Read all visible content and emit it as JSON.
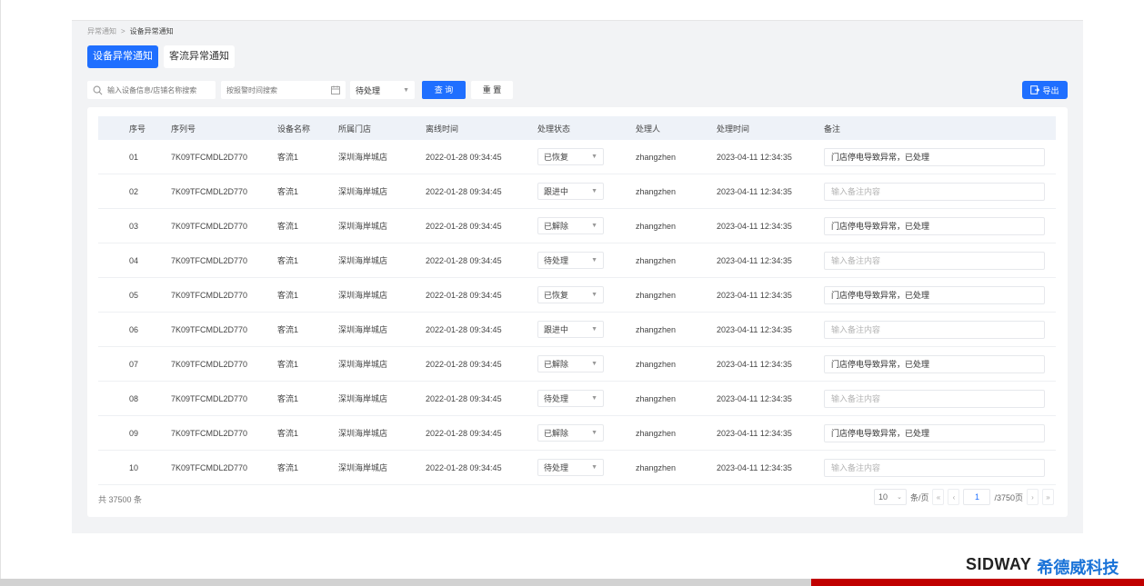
{
  "breadcrumb": {
    "parent": "异常通知",
    "separator": ">",
    "current": "设备异常通知"
  },
  "tabs": [
    {
      "label": "设备异常通知",
      "active": true
    },
    {
      "label": "客流异常通知",
      "active": false
    }
  ],
  "filters": {
    "search_placeholder": "输入设备信息/店铺名称搜索",
    "date_placeholder": "按报警时间搜索",
    "status_value": "待处理",
    "query_label": "查 询",
    "reset_label": "重 置",
    "export_label": "导出"
  },
  "table": {
    "columns": [
      "序号",
      "序列号",
      "设备名称",
      "所属门店",
      "离线时间",
      "处理状态",
      "处理人",
      "处理时间",
      "备注"
    ],
    "rows": [
      {
        "no": "01",
        "serial": "7K09TFCMDL2D770",
        "device": "客流1",
        "store": "深圳海岸城店",
        "offline": "2022-01-28 09:34:45",
        "status": "已恢复",
        "handler": "zhangzhen",
        "handled": "2023-04-11 12:34:35",
        "remark": "门店停电导致异常，已处理",
        "remark_ph": ""
      },
      {
        "no": "02",
        "serial": "7K09TFCMDL2D770",
        "device": "客流1",
        "store": "深圳海岸城店",
        "offline": "2022-01-28 09:34:45",
        "status": "跟进中",
        "handler": "zhangzhen",
        "handled": "2023-04-11 12:34:35",
        "remark": "",
        "remark_ph": "输入备注内容"
      },
      {
        "no": "03",
        "serial": "7K09TFCMDL2D770",
        "device": "客流1",
        "store": "深圳海岸城店",
        "offline": "2022-01-28 09:34:45",
        "status": "已解除",
        "handler": "zhangzhen",
        "handled": "2023-04-11 12:34:35",
        "remark": "门店停电导致异常，已处理",
        "remark_ph": ""
      },
      {
        "no": "04",
        "serial": "7K09TFCMDL2D770",
        "device": "客流1",
        "store": "深圳海岸城店",
        "offline": "2022-01-28 09:34:45",
        "status": "待处理",
        "handler": "zhangzhen",
        "handled": "2023-04-11 12:34:35",
        "remark": "",
        "remark_ph": "输入备注内容"
      },
      {
        "no": "05",
        "serial": "7K09TFCMDL2D770",
        "device": "客流1",
        "store": "深圳海岸城店",
        "offline": "2022-01-28 09:34:45",
        "status": "已恢复",
        "handler": "zhangzhen",
        "handled": "2023-04-11 12:34:35",
        "remark": "门店停电导致异常，已处理",
        "remark_ph": ""
      },
      {
        "no": "06",
        "serial": "7K09TFCMDL2D770",
        "device": "客流1",
        "store": "深圳海岸城店",
        "offline": "2022-01-28 09:34:45",
        "status": "跟进中",
        "handler": "zhangzhen",
        "handled": "2023-04-11 12:34:35",
        "remark": "",
        "remark_ph": "输入备注内容"
      },
      {
        "no": "07",
        "serial": "7K09TFCMDL2D770",
        "device": "客流1",
        "store": "深圳海岸城店",
        "offline": "2022-01-28 09:34:45",
        "status": "已解除",
        "handler": "zhangzhen",
        "handled": "2023-04-11 12:34:35",
        "remark": "门店停电导致异常，已处理",
        "remark_ph": ""
      },
      {
        "no": "08",
        "serial": "7K09TFCMDL2D770",
        "device": "客流1",
        "store": "深圳海岸城店",
        "offline": "2022-01-28 09:34:45",
        "status": "待处理",
        "handler": "zhangzhen",
        "handled": "2023-04-11 12:34:35",
        "remark": "",
        "remark_ph": "输入备注内容"
      },
      {
        "no": "09",
        "serial": "7K09TFCMDL2D770",
        "device": "客流1",
        "store": "深圳海岸城店",
        "offline": "2022-01-28 09:34:45",
        "status": "已解除",
        "handler": "zhangzhen",
        "handled": "2023-04-11 12:34:35",
        "remark": "门店停电导致异常，已处理",
        "remark_ph": ""
      },
      {
        "no": "10",
        "serial": "7K09TFCMDL2D770",
        "device": "客流1",
        "store": "深圳海岸城店",
        "offline": "2022-01-28 09:34:45",
        "status": "待处理",
        "handler": "zhangzhen",
        "handled": "2023-04-11 12:34:35",
        "remark": "",
        "remark_ph": "输入备注内容"
      }
    ]
  },
  "pagination": {
    "total": "共 37500 条",
    "page_size": "10",
    "page_size_unit": "条/页",
    "first": "«",
    "prev": "‹",
    "current_page": "1",
    "total_pages": "/3750页",
    "next": "›",
    "last": "»"
  },
  "brand": {
    "en": "SIDWAY",
    "cn": "希德威科技"
  },
  "colors": {
    "primary": "#1f6fff",
    "brand_red": "#c00000",
    "brand_blue": "#1a73d8"
  },
  "icons": {
    "search": "search-icon",
    "calendar": "calendar-icon",
    "export": "export-icon",
    "caret": "caret-down-icon"
  }
}
